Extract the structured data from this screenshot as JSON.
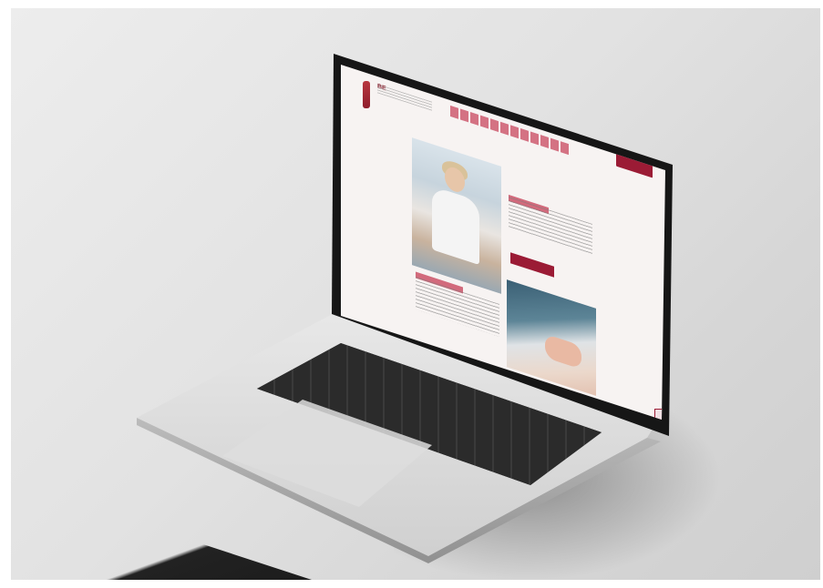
{
  "scene": {
    "description_colors": {
      "background": "#e4e4e4",
      "accent": "#9b1b35",
      "laptop_body": "#d5d5d5",
      "keyboard": "#2b2b2b"
    }
  },
  "website": {
    "logo_text": "BE",
    "icons": [
      "logo-caduceus-icon"
    ]
  }
}
